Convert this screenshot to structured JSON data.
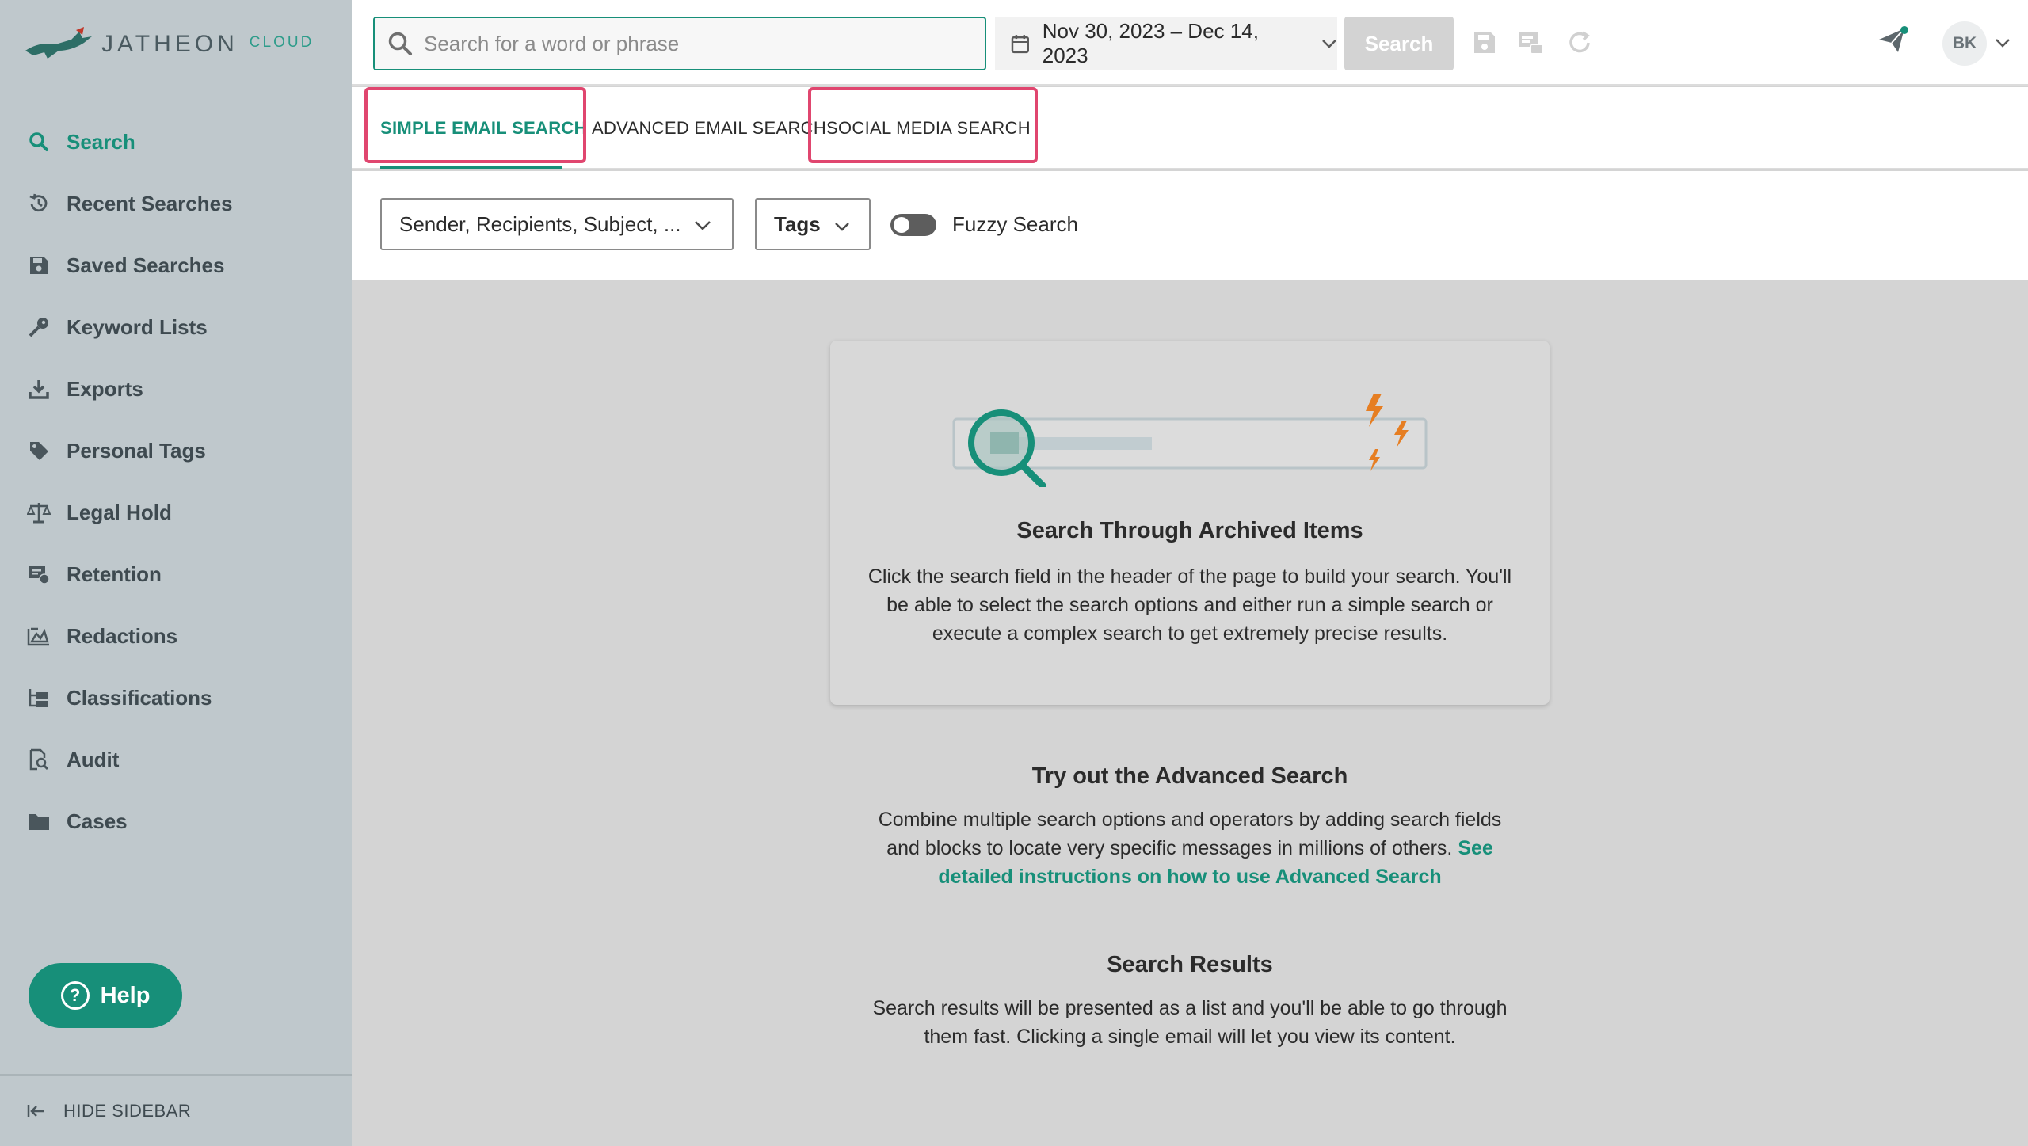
{
  "brand": {
    "word": "JATHEON",
    "sub": "CLOUD",
    "accent": "#178f79"
  },
  "sidebar": {
    "items": [
      {
        "label": "Search",
        "icon": "search-icon"
      },
      {
        "label": "Recent Searches",
        "icon": "history-icon"
      },
      {
        "label": "Saved Searches",
        "icon": "save-icon"
      },
      {
        "label": "Keyword Lists",
        "icon": "key-icon"
      },
      {
        "label": "Exports",
        "icon": "download-icon"
      },
      {
        "label": "Personal Tags",
        "icon": "tag-icon"
      },
      {
        "label": "Legal Hold",
        "icon": "scale-icon"
      },
      {
        "label": "Retention",
        "icon": "retention-icon"
      },
      {
        "label": "Redactions",
        "icon": "redaction-icon"
      },
      {
        "label": "Classifications",
        "icon": "classification-icon"
      },
      {
        "label": "Audit",
        "icon": "audit-icon"
      },
      {
        "label": "Cases",
        "icon": "folder-icon"
      }
    ],
    "help_label": "Help",
    "hide_label": "HIDE SIDEBAR"
  },
  "header": {
    "search_placeholder": "Search for a word or phrase",
    "date_range": "Nov 30, 2023 – Dec 14, 2023",
    "search_button": "Search",
    "avatar_initials": "BK"
  },
  "tabs": [
    {
      "label": "SIMPLE EMAIL SEARCH",
      "active": true
    },
    {
      "label": "ADVANCED EMAIL SEARCH",
      "active": false
    },
    {
      "label": "SOCIAL MEDIA SEARCH",
      "active": false
    }
  ],
  "options": {
    "fields_dropdown": "Sender, Recipients, Subject, ...",
    "tags_dropdown": "Tags",
    "fuzzy_label": "Fuzzy Search"
  },
  "main": {
    "card_title": "Search Through Archived Items",
    "card_text": "Click the search field in the header of the page to build your search. You'll be able to select the search options and either run a simple search or execute a complex search to get extremely precise results.",
    "advanced_title": "Try out the Advanced Search",
    "advanced_text": "Combine multiple search options and operators by adding search fields and blocks to locate very specific messages in millions of others.",
    "advanced_link": "See detailed instructions on how to use Advanced Search",
    "results_title": "Search Results",
    "results_text": "Search results will be presented as a list and you'll be able to go through them fast. Clicking a single email will let you view its content."
  }
}
